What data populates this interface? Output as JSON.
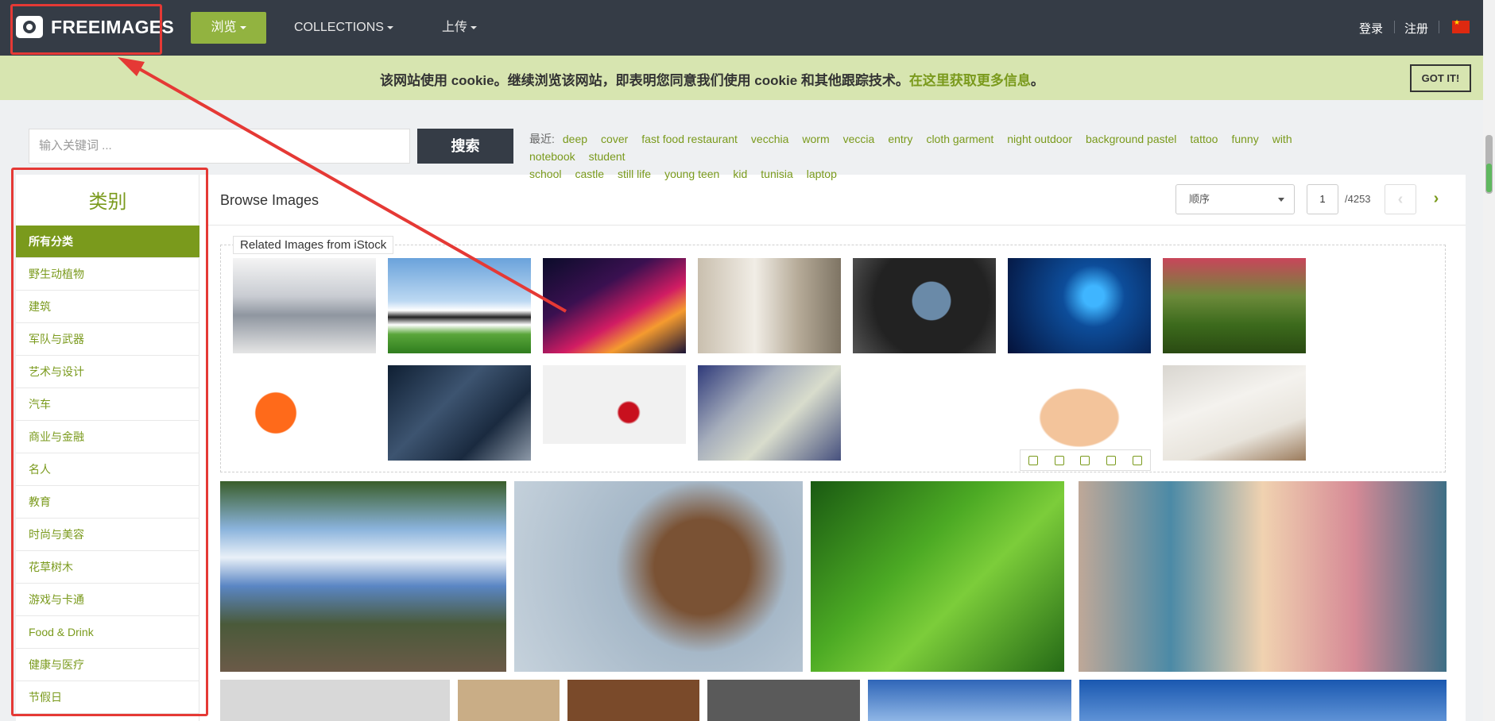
{
  "nav": {
    "logo_text": "FREEIMAGES",
    "browse": "浏览",
    "collections": "COLLECTIONS",
    "upload": "上传",
    "login": "登录",
    "register": "注册"
  },
  "cookie": {
    "text": "该网站使用 cookie。继续浏览该网站，即表明您同意我们使用 cookie 和其他跟踪技术。",
    "link": "在这里获取更多信息",
    "end": "。",
    "button": "GOT IT!"
  },
  "search": {
    "placeholder": "输入关键词 ...",
    "button": "搜索",
    "recent_label": "最近:",
    "recent": [
      "deep",
      "cover",
      "fast food restaurant",
      "vecchia",
      "worm",
      "veccia",
      "entry",
      "cloth garment",
      "night outdoor",
      "background pastel",
      "tattoo",
      "funny",
      "with notebook",
      "student",
      "school",
      "castle",
      "still life",
      "young teen",
      "kid",
      "tunisia",
      "laptop"
    ]
  },
  "sidebar": {
    "title": "类别",
    "items": [
      "所有分类",
      "野生动植物",
      "建筑",
      "军队与武器",
      "艺术与设计",
      "汽车",
      "商业与金融",
      "名人",
      "教育",
      "时尚与美容",
      "花草树木",
      "游戏与卡通",
      "Food & Drink",
      "健康与医疗",
      "节假日"
    ]
  },
  "main": {
    "title": "Browse Images",
    "order": "顺序",
    "page": "1",
    "total": "/4253",
    "related_label": "Related Images from iStock"
  }
}
